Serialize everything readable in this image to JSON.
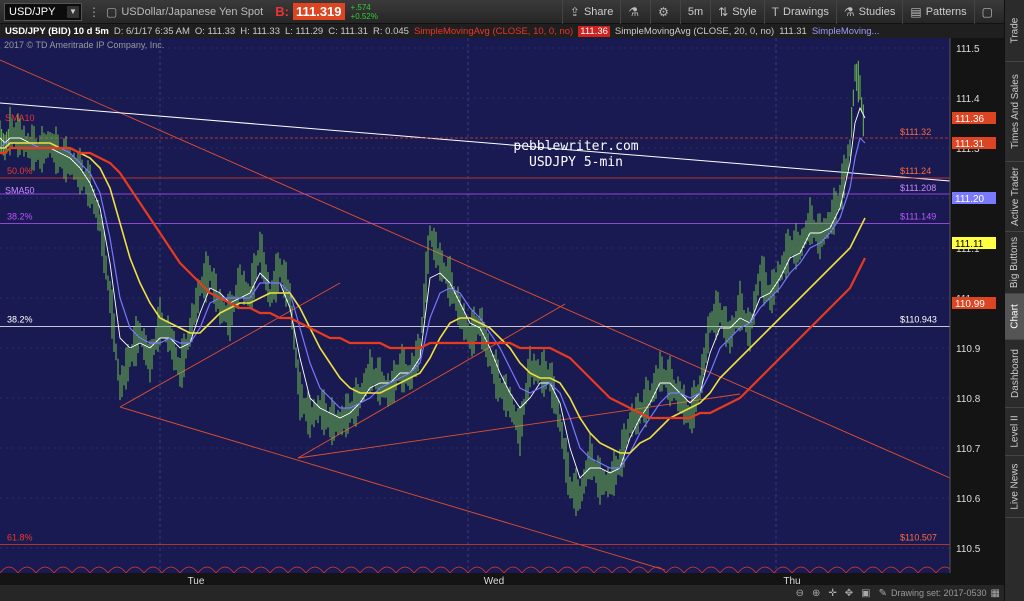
{
  "toolbar": {
    "symbol": "USD/JPY",
    "description": "USDollar/Japanese Yen Spot",
    "bid_label": "B:",
    "bid_value": "111.319",
    "change_abs": "+.574",
    "change_pct": "+0.52%",
    "share_label": "Share",
    "timeframe_label": "5m",
    "style_label": "Style",
    "drawings_label": "Drawings",
    "studies_label": "Studies",
    "patterns_label": "Patterns"
  },
  "side_tabs": [
    "Trade",
    "Times And Sales",
    "Active Trader",
    "Big Buttons",
    "Chart",
    "Dashboard",
    "Level II",
    "Live News"
  ],
  "infobar": {
    "title": "USD/JPY (BID) 10 d 5m",
    "date": "D: 6/1/17 6:35 AM",
    "open": "O: 111.33",
    "high": "H: 111.33",
    "low": "L: 111.29",
    "close": "C: 111.31",
    "range": "R: 0.045",
    "sma10_label": "SimpleMovingAvg (CLOSE, 10, 0, no)",
    "sma10_value": "111.36",
    "sma20_label": "SimpleMovingAvg (CLOSE, 20, 0, no)",
    "sma20_value": "111.31",
    "sma50_label": "SimpleMoving..."
  },
  "copyright": "2017 © TD Ameritrade IP Company, Inc.",
  "statusbar": {
    "drawing_set": "Drawing set: 2017-0530"
  },
  "chart_data": {
    "type": "line",
    "annotation_title": "pebblewriter.com",
    "annotation_subtitle": "USDJPY 5-min",
    "x_ticks": [
      "Tue",
      "Wed",
      "Thu"
    ],
    "y_ticks": [
      "110.5",
      "110.6",
      "110.7",
      "110.8",
      "110.9",
      "111",
      "111.1",
      "111.2",
      "111.3",
      "111.4",
      "111.5"
    ],
    "ylim": [
      110.45,
      111.52
    ],
    "fib_levels": [
      {
        "label": "50.0%",
        "value": 111.24,
        "price_label": "$111.24"
      },
      {
        "label": "38.2%",
        "value": 111.149,
        "price_label": "$111.149"
      },
      {
        "label": "38.2%",
        "value": 110.943,
        "price_label": "$110.943"
      },
      {
        "label": "61.8%",
        "value": 110.507,
        "price_label": "$110.507"
      }
    ],
    "hlines": [
      {
        "value": 111.32,
        "price_label": "$111.32",
        "color": "#e83a2a"
      },
      {
        "value": 111.208,
        "price_label": "$111.208",
        "color": "#bb55ff"
      }
    ],
    "left_labels": [
      {
        "label": "SMA10",
        "value": 111.35,
        "color": "#e33"
      },
      {
        "label": "SMA50",
        "value": 111.205,
        "color": "#cc88ff"
      }
    ],
    "right_markers": [
      {
        "text": "111.36",
        "value": 111.36,
        "bg": "#d42",
        "fg": "#fff"
      },
      {
        "text": "111.31",
        "value": 111.31,
        "bg": "#d42",
        "fg": "#fff"
      },
      {
        "text": "111.20",
        "value": 111.2,
        "bg": "#7a7aff",
        "fg": "#fff"
      },
      {
        "text": "111.11",
        "value": 111.11,
        "bg": "#ffff44",
        "fg": "#000"
      },
      {
        "text": "110.99",
        "value": 110.99,
        "bg": "#d42",
        "fg": "#fff"
      }
    ],
    "x": [
      0,
      5,
      10,
      20,
      30,
      40,
      50,
      60,
      70,
      80,
      90,
      100,
      110,
      120,
      130,
      140,
      150,
      160,
      170,
      180,
      190,
      200,
      210,
      220,
      230,
      240,
      250,
      260,
      270,
      280,
      290,
      300,
      310,
      320,
      330,
      340,
      350,
      360,
      370,
      380,
      390,
      400,
      410,
      420,
      430,
      440,
      450,
      460,
      470,
      480,
      490,
      500,
      510,
      520,
      530,
      540,
      550,
      560,
      570,
      580,
      590,
      600,
      610,
      620,
      630,
      640,
      650,
      660,
      670,
      680,
      690,
      700,
      710,
      720,
      730,
      740,
      750,
      760,
      770,
      780,
      790,
      800,
      810,
      820,
      830,
      840,
      850,
      855,
      860,
      865
    ],
    "series": [
      {
        "values": [
          111.32,
          111.3,
          111.33,
          111.32,
          111.3,
          111.29,
          111.31,
          111.28,
          111.27,
          111.25,
          111.22,
          111.15,
          111.0,
          110.82,
          110.88,
          110.93,
          110.87,
          110.95,
          110.92,
          110.85,
          110.93,
          111.02,
          111.05,
          110.98,
          110.96,
          111.03,
          111.0,
          111.1,
          111.0,
          111.06,
          111.0,
          110.8,
          110.76,
          110.78,
          110.75,
          110.75,
          110.77,
          110.8,
          110.85,
          110.83,
          110.81,
          110.86,
          110.84,
          110.9,
          111.13,
          111.07,
          111.03,
          110.97,
          110.92,
          110.95,
          110.88,
          110.82,
          110.79,
          110.73,
          110.86,
          110.85,
          110.84,
          110.75,
          110.62,
          110.6,
          110.68,
          110.63,
          110.63,
          110.67,
          110.75,
          110.77,
          110.8,
          110.85,
          110.83,
          110.8,
          110.76,
          110.82,
          110.95,
          110.97,
          110.92,
          110.98,
          110.93,
          111.05,
          111.0,
          111.05,
          111.1,
          111.1,
          111.15,
          111.12,
          111.15,
          111.2,
          111.3,
          111.45,
          111.42,
          111.32
        ]
      },
      {
        "name": "SMA10",
        "values": [
          111.32,
          111.31,
          111.32,
          111.32,
          111.31,
          111.3,
          111.3,
          111.29,
          111.28,
          111.26,
          111.23,
          111.18,
          111.07,
          110.92,
          110.9,
          110.91,
          110.9,
          110.92,
          110.92,
          110.9,
          110.91,
          110.97,
          111.02,
          111.01,
          110.99,
          111.0,
          111.01,
          111.05,
          111.03,
          111.03,
          110.98,
          110.88,
          110.8,
          110.78,
          110.77,
          110.76,
          110.77,
          110.79,
          110.82,
          110.83,
          110.83,
          110.85,
          110.85,
          110.88,
          111.04,
          111.05,
          111.03,
          110.99,
          110.95,
          110.94,
          110.9,
          110.85,
          110.81,
          110.78,
          110.8,
          110.83,
          110.83,
          110.79,
          110.7,
          110.64,
          110.66,
          110.66,
          110.65,
          110.66,
          110.72,
          110.76,
          110.79,
          110.83,
          110.83,
          110.81,
          110.79,
          110.81,
          110.89,
          110.94,
          110.94,
          110.96,
          110.95,
          111.0,
          111.01,
          111.04,
          111.08,
          111.09,
          111.13,
          111.13,
          111.14,
          111.18,
          111.27,
          111.35,
          111.38,
          111.36
        ]
      },
      {
        "name": "SMA20",
        "values": [
          111.3,
          111.31,
          111.31,
          111.31,
          111.31,
          111.3,
          111.3,
          111.3,
          111.29,
          111.27,
          111.25,
          111.21,
          111.12,
          111.0,
          110.94,
          110.92,
          110.91,
          110.91,
          110.92,
          110.91,
          110.91,
          110.94,
          110.99,
          111.0,
          111.0,
          111.0,
          111.0,
          111.03,
          111.03,
          111.03,
          111.01,
          110.94,
          110.87,
          110.82,
          110.8,
          110.78,
          110.78,
          110.79,
          110.8,
          110.82,
          110.83,
          110.84,
          110.85,
          110.87,
          110.96,
          111.01,
          111.02,
          111.01,
          110.98,
          110.96,
          110.93,
          110.9,
          110.86,
          110.82,
          110.81,
          110.82,
          110.83,
          110.81,
          110.76,
          110.7,
          110.68,
          110.67,
          110.66,
          110.66,
          110.69,
          110.73,
          110.76,
          110.79,
          110.81,
          110.81,
          110.8,
          110.81,
          110.85,
          110.9,
          110.92,
          110.94,
          110.95,
          110.98,
          111.0,
          111.02,
          111.05,
          111.07,
          111.1,
          111.11,
          111.13,
          111.16,
          111.22,
          111.28,
          111.32,
          111.31
        ]
      },
      {
        "name": "SMA50",
        "values": [
          111.3,
          111.3,
          111.31,
          111.31,
          111.31,
          111.31,
          111.31,
          111.3,
          111.3,
          111.29,
          111.28,
          111.26,
          111.22,
          111.15,
          111.08,
          111.03,
          110.99,
          110.96,
          110.95,
          110.94,
          110.93,
          110.93,
          110.95,
          110.97,
          110.98,
          110.99,
          110.99,
          111.0,
          111.01,
          111.01,
          111.01,
          110.98,
          110.94,
          110.9,
          110.87,
          110.84,
          110.82,
          110.81,
          110.81,
          110.81,
          110.82,
          110.83,
          110.84,
          110.85,
          110.88,
          110.92,
          110.95,
          110.96,
          110.96,
          110.95,
          110.94,
          110.92,
          110.9,
          110.87,
          110.85,
          110.84,
          110.84,
          110.83,
          110.8,
          110.76,
          110.73,
          110.71,
          110.7,
          110.69,
          110.69,
          110.71,
          110.72,
          110.74,
          110.76,
          110.77,
          110.78,
          110.79,
          110.81,
          110.84,
          110.86,
          110.88,
          110.9,
          110.92,
          110.94,
          110.96,
          110.98,
          111.0,
          111.02,
          111.04,
          111.06,
          111.08,
          111.1,
          111.12,
          111.14,
          111.16
        ]
      },
      {
        "name": "SMA100",
        "values": [
          111.29,
          111.29,
          111.3,
          111.3,
          111.3,
          111.3,
          111.3,
          111.3,
          111.3,
          111.29,
          111.29,
          111.28,
          111.27,
          111.25,
          111.22,
          111.19,
          111.16,
          111.13,
          111.1,
          111.07,
          111.05,
          111.03,
          111.01,
          111.0,
          110.99,
          110.98,
          110.98,
          110.97,
          110.97,
          110.96,
          110.96,
          110.95,
          110.94,
          110.93,
          110.92,
          110.92,
          110.91,
          110.91,
          110.91,
          110.91,
          110.9,
          110.9,
          110.9,
          110.9,
          110.91,
          110.91,
          110.91,
          110.91,
          110.91,
          110.91,
          110.91,
          110.91,
          110.91,
          110.9,
          110.9,
          110.9,
          110.9,
          110.89,
          110.88,
          110.86,
          110.84,
          110.82,
          110.8,
          110.79,
          110.78,
          110.77,
          110.76,
          110.76,
          110.76,
          110.76,
          110.76,
          110.77,
          110.77,
          110.78,
          110.79,
          110.8,
          110.82,
          110.84,
          110.86,
          110.88,
          110.9,
          110.92,
          110.94,
          110.96,
          110.98,
          111.0,
          111.02,
          111.04,
          111.06,
          111.08
        ]
      }
    ],
    "colors": {
      "background": "#1a1a52",
      "price": "#6fbf4a",
      "sma10": "#ffffff",
      "sma20": "#7777ff",
      "sma50": "#f0e040",
      "sma100": "#e83a1e",
      "trendline": "#e05030",
      "white_line": "#ffffff",
      "grid": "#3a3a7a"
    }
  }
}
